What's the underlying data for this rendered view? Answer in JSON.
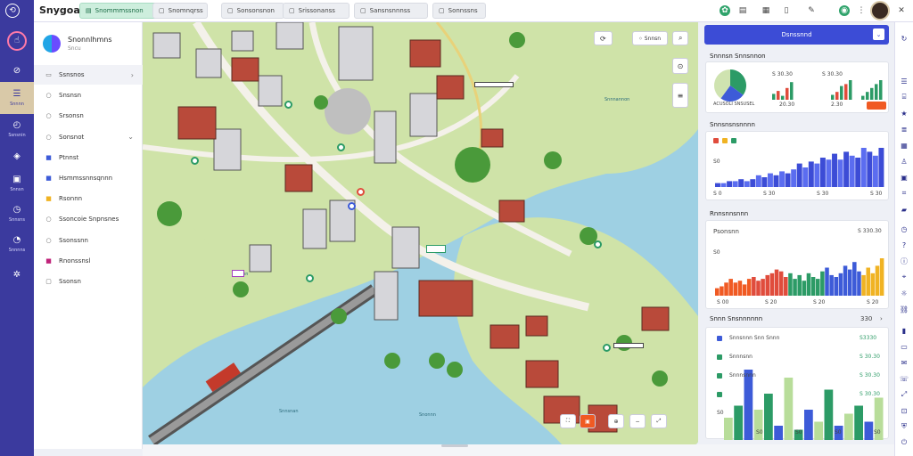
{
  "app": {
    "brand": "Snygoari"
  },
  "top_tabs": [
    {
      "label": "Snommmssnon",
      "icon": "doc-icon",
      "active": true
    },
    {
      "label": "Snomnqrss",
      "icon": "square-icon",
      "active": false
    },
    {
      "label": "Sonsonsnon",
      "icon": "square-icon",
      "active": false
    },
    {
      "label": "Srissonanss",
      "icon": "square-icon",
      "active": false
    },
    {
      "label": "Sansnsnnnss",
      "icon": "square-icon",
      "active": false
    },
    {
      "label": "Sonnssns",
      "icon": "square-icon",
      "active": false
    }
  ],
  "rail": [
    {
      "label": "",
      "icon": "hand-icon"
    },
    {
      "label": "",
      "icon": "compass-icon"
    },
    {
      "label": "Snnnn",
      "icon": "list-icon"
    },
    {
      "label": "Ssnsnin",
      "icon": "chart-icon"
    },
    {
      "label": "",
      "icon": "layers-icon"
    },
    {
      "label": "Snnsn",
      "icon": "bag-icon"
    },
    {
      "label": "Snnsns",
      "icon": "clock-icon"
    },
    {
      "label": "Snnnns",
      "icon": "gauge-icon"
    },
    {
      "label": "",
      "icon": "settings-icon"
    }
  ],
  "sidebar": {
    "profile_name": "Snonnlhmns",
    "profile_sub": "Sncu",
    "items": [
      {
        "label": "Ssnsnos",
        "icon": "home-icon",
        "chevron": "›",
        "active": true
      },
      {
        "label": "Snsnsn",
        "icon": "circle-icon",
        "chevron": "",
        "active": false
      },
      {
        "label": "Srsonsn",
        "icon": "circle-icon",
        "chevron": "",
        "active": false
      },
      {
        "label": "Sonsnot",
        "icon": "circle-icon",
        "chevron": "⌄",
        "active": false
      },
      {
        "label": "Ptnnst",
        "icon": "blue-square-icon",
        "chevron": "",
        "active": false
      },
      {
        "label": "Hsmmssnnsqnnn",
        "icon": "blue-square-icon",
        "chevron": "",
        "active": false
      },
      {
        "label": "Rsonnn",
        "icon": "yellow-square-icon",
        "chevron": "",
        "active": false
      },
      {
        "label": "Ssoncoie Snpnsnes",
        "icon": "circle-icon",
        "chevron": "",
        "active": false
      },
      {
        "label": "Ssonssnn",
        "icon": "circle-icon",
        "chevron": "",
        "active": false
      },
      {
        "label": "Rnonssnsl",
        "icon": "pink-square-icon",
        "chevron": "",
        "active": false
      },
      {
        "label": "Ssonsn",
        "icon": "square-icon",
        "chevron": "",
        "active": false
      }
    ]
  },
  "map": {
    "search_chip": "Snnsn",
    "labels": [
      {
        "text": "Snnnannon"
      },
      {
        "text": "Snnsnan"
      },
      {
        "text": "Snonnn"
      },
      {
        "text": "Snnsnn"
      }
    ],
    "bottom_controls": [
      "⛶",
      "▣",
      "⊕",
      "−",
      "⤢"
    ]
  },
  "right": {
    "header": "Dsnssnnd",
    "card1": {
      "title": "Snnnsn Snnsnnon",
      "top_values": [
        "S 30.30",
        "S 30.30"
      ],
      "bottom_values": [
        "20.30",
        "2.30"
      ],
      "footer": "ACUSOLI SNSUSEL"
    },
    "card2": {
      "title": "Snnsnsnsnnnn",
      "y_label": "S0",
      "ticks": [
        "S 0",
        "S 30",
        "S 30",
        "S 30"
      ]
    },
    "card3": {
      "title": "Rnnsnnsnnn",
      "name": "Psonsnn",
      "value": "S 330.30",
      "y_label": "S0",
      "ticks": [
        "S 00",
        "S 20",
        "S 20",
        "S 20"
      ]
    },
    "card4": {
      "title": "Snnn Snsnnnnnn",
      "header_value": "330",
      "rows": [
        {
          "name": "Snnsnnn Snn Snnn",
          "value": "S3330"
        },
        {
          "name": "Snnnsnn",
          "value": "S 30.30"
        },
        {
          "name": "Snnnsnnn",
          "value": "S 30.30"
        },
        {
          "name": "",
          "value": "S 30.30"
        }
      ],
      "axis": [
        "S0",
        "S0",
        "S0",
        "S0",
        "S0"
      ]
    }
  },
  "colors": {
    "rail": "#3b3a9e",
    "accent": "#3c4cd6",
    "green": "#2c9b66",
    "orange": "#f05a23"
  },
  "chart_data": [
    {
      "type": "bar",
      "title": "Snnnsn Snnsnnon",
      "series": [
        {
          "values": [
            6,
            9,
            4,
            12,
            18
          ]
        },
        {
          "values": [
            5,
            8,
            14,
            16,
            20
          ]
        }
      ]
    },
    {
      "type": "area",
      "title": "Snnsnsnsnnnn",
      "values": [
        2,
        2,
        3,
        3,
        4,
        3,
        4,
        6,
        5,
        7,
        6,
        8,
        7,
        9,
        12,
        10,
        13,
        12,
        15,
        14,
        17,
        14,
        18,
        16,
        15,
        20,
        18,
        16,
        20
      ]
    },
    {
      "type": "bar",
      "title": "Rnnsnnsnnn",
      "values": [
        4,
        5,
        7,
        9,
        7,
        8,
        6,
        9,
        10,
        8,
        9,
        11,
        12,
        14,
        13,
        10,
        12,
        9,
        11,
        8,
        12,
        10,
        9,
        13,
        15,
        11,
        10,
        12,
        16,
        14,
        18,
        13,
        11,
        15,
        12,
        16,
        20
      ]
    },
    {
      "type": "bar",
      "title": "Snnn Snsnnnnnn",
      "values": [
        6,
        9,
        18,
        8,
        12,
        4,
        16,
        3,
        8,
        5,
        13,
        4,
        7,
        9,
        5,
        11
      ]
    }
  ]
}
